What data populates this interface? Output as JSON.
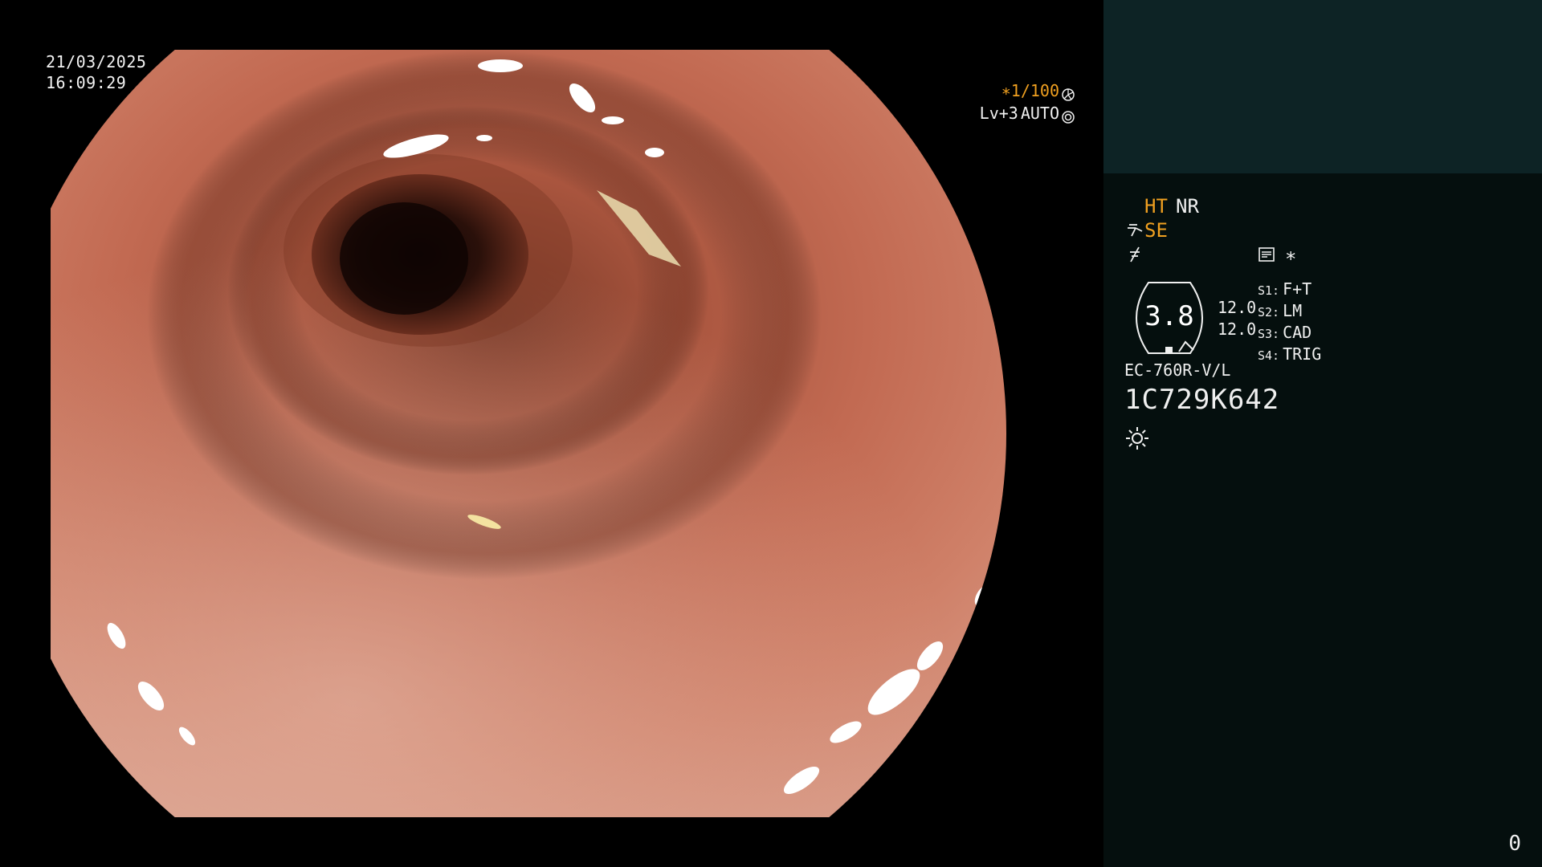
{
  "overlay": {
    "date": "21/03/2025",
    "time": "16:09:29",
    "shutter": "∗1/100",
    "level": "Lv+3",
    "mode": "AUTO"
  },
  "settings": {
    "ht": "HT",
    "nr": "NR",
    "se": "SE",
    "asterisk": "∗",
    "aperture_value": "3.8",
    "value_1": "12.0",
    "value_2": "12.0",
    "switches": [
      {
        "key": "S1:",
        "label": "F+T"
      },
      {
        "key": "S2:",
        "label": "LM"
      },
      {
        "key": "S3:",
        "label": "CAD"
      },
      {
        "key": "S4:",
        "label": "TRIG"
      }
    ],
    "scope_model": "EC-760R-V/L",
    "scope_serial": "1C729K642"
  },
  "counter": "0",
  "colors": {
    "accent_orange": "#f0a020",
    "panel_top": "#0d2325",
    "panel_bottom": "#050f0e",
    "mucosa": "#c06650"
  },
  "icons": {
    "shutter": "aperture-wheel-icon",
    "mode": "target-icon",
    "se": "scope-tip-icon",
    "enhancement": "slash-f-icon",
    "memo": "memo-icon",
    "light": "sun-icon"
  }
}
